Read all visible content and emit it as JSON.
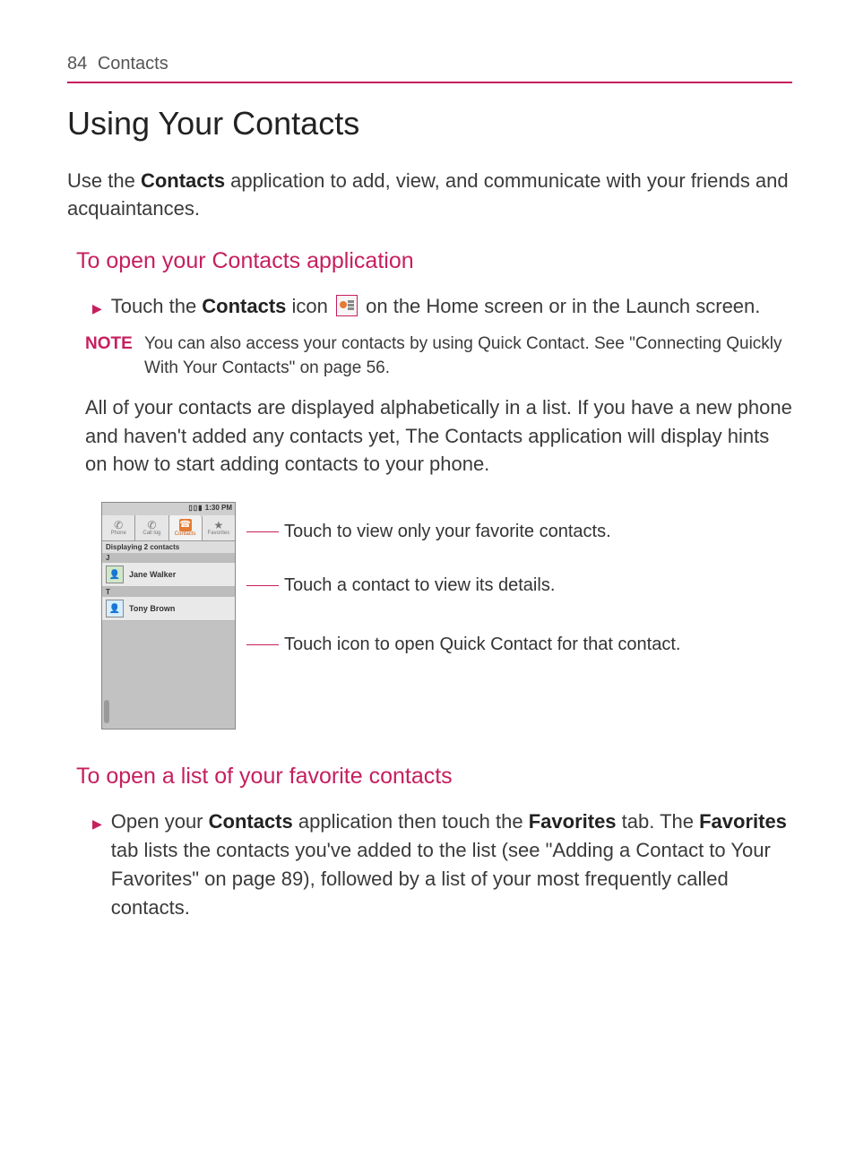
{
  "header": {
    "page_number": "84",
    "section": "Contacts"
  },
  "title": "Using Your Contacts",
  "intro": {
    "pre": "Use the ",
    "bold": "Contacts",
    "post": " application to add, view, and communicate with your friends and acquaintances."
  },
  "h2a": "To open your Contacts application",
  "bullet1": {
    "pre": "Touch the ",
    "bold": "Contacts",
    "mid": " icon ",
    "post": " on the Home screen or in the Launch screen."
  },
  "note": {
    "label": "NOTE",
    "text": "You can also access your contacts by using Quick Contact. See \"Connecting Quickly With Your Contacts\" on page 56."
  },
  "para1": "All of your contacts are displayed alphabetically in a list. If you have a new phone and haven't added any contacts yet, The Contacts application will display hints on how to start adding contacts to your phone.",
  "screenshot": {
    "time": "1:30 PM",
    "tab_phone": "Phone",
    "tab_calllog": "Call log",
    "tab_contacts": "Contacts",
    "tab_favorites": "Favorites",
    "displaying": "Displaying 2 contacts",
    "divider_j": "J",
    "contact_j": "Jane Walker",
    "divider_t": "T",
    "contact_t": "Tony Brown"
  },
  "callouts": {
    "c1": "Touch to view only your favorite contacts.",
    "c2": "Touch a contact to view its details.",
    "c3": "Touch icon to open Quick Contact for that contact."
  },
  "h2b": "To open a list of your favorite contacts",
  "bullet2": {
    "pre": "Open your ",
    "b1": "Contacts",
    "mid1": " application then touch the ",
    "b2": "Favorites",
    "mid2": " tab. The ",
    "b3": "Favorites",
    "post": " tab lists the contacts you've added to the list (see \"Adding a Contact to Your Favorites\" on page 89), followed by a list of your most frequently called contacts."
  }
}
